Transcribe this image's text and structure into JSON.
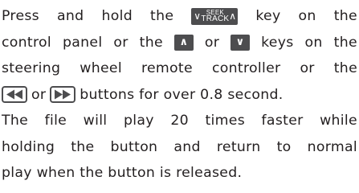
{
  "paragraph": {
    "line1": {
      "w1": "Press",
      "w2": "and",
      "w3": "hold",
      "w4": "the",
      "w5": "key",
      "w6": "on",
      "w7": "the"
    },
    "line2": {
      "w1": "control",
      "w2": "panel",
      "w3": "or",
      "w4": "the",
      "w5": "or",
      "w6": "keys",
      "w7": "on",
      "w8": "the"
    },
    "line3": {
      "w1": "steering",
      "w2": "wheel",
      "w3": "remote",
      "w4": "controller",
      "w5": "or",
      "w6": "the"
    },
    "line4": {
      "w1": "or",
      "w2": "buttons for over 0.8 second."
    },
    "line5": {
      "w1": "The",
      "w2": "file",
      "w3": "will",
      "w4": "play",
      "w5": "20",
      "w6": "times",
      "w7": "faster",
      "w8": "while"
    },
    "line6": {
      "w1": "holding",
      "w2": "the",
      "w3": "button",
      "w4": "and",
      "w5": "return",
      "w6": "to",
      "w7": "normal"
    },
    "line7": {
      "text": "play when the button is released."
    }
  },
  "keys": {
    "seek_track": {
      "left_chevron": "∨",
      "top_label": "SEEK",
      "bottom_label": "TRACK",
      "right_chevron": "∧",
      "icon": "seek-track-icon"
    },
    "up": {
      "glyph": "∧",
      "icon": "up-arrow-icon"
    },
    "down": {
      "glyph": "∨",
      "icon": "down-arrow-icon"
    },
    "rewind": {
      "icon": "rewind-icon"
    },
    "fast_forward": {
      "icon": "fast-forward-icon"
    }
  },
  "colors": {
    "text": "#231f20",
    "key_fill": "#4d4d4f",
    "key_text": "#ffffff"
  }
}
